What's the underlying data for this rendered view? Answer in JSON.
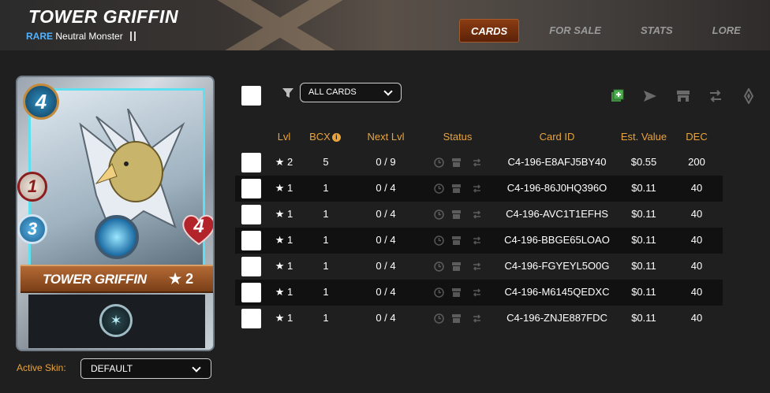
{
  "header": {
    "title": "TOWER GRIFFIN",
    "rarity": "RARE",
    "type_text": "Neutral Monster",
    "tabs": [
      {
        "label": "CARDS",
        "active": true
      },
      {
        "label": "FOR SALE",
        "active": false
      },
      {
        "label": "STATS",
        "active": false
      },
      {
        "label": "LORE",
        "active": false
      }
    ]
  },
  "card": {
    "name": "TOWER GRIFFIN",
    "level_text": "★ 2",
    "mana": "4",
    "melee": "1",
    "speed": "3",
    "health": "4"
  },
  "skin": {
    "label": "Active Skin:",
    "value": "DEFAULT"
  },
  "filter": {
    "value": "ALL CARDS"
  },
  "toolbar": {
    "icons": [
      "add-to-deck-icon",
      "send-icon",
      "market-icon",
      "transfer-icon",
      "burn-icon"
    ]
  },
  "table": {
    "headers": {
      "lvl": "Lvl",
      "bcx": "BCX",
      "next_lvl": "Next Lvl",
      "status": "Status",
      "card_id": "Card ID",
      "est_value": "Est. Value",
      "dec": "DEC"
    },
    "rows": [
      {
        "lvl": "★ 2",
        "bcx": "5",
        "next": "0 / 9",
        "id": "C4-196-E8AFJ5BY40",
        "value": "$0.55",
        "dec": "200"
      },
      {
        "lvl": "★ 1",
        "bcx": "1",
        "next": "0 / 4",
        "id": "C4-196-86J0HQ396O",
        "value": "$0.11",
        "dec": "40"
      },
      {
        "lvl": "★ 1",
        "bcx": "1",
        "next": "0 / 4",
        "id": "C4-196-AVC1T1EFHS",
        "value": "$0.11",
        "dec": "40"
      },
      {
        "lvl": "★ 1",
        "bcx": "1",
        "next": "0 / 4",
        "id": "C4-196-BBGE65LOAO",
        "value": "$0.11",
        "dec": "40"
      },
      {
        "lvl": "★ 1",
        "bcx": "1",
        "next": "0 / 4",
        "id": "C4-196-FGYEYL5O0G",
        "value": "$0.11",
        "dec": "40"
      },
      {
        "lvl": "★ 1",
        "bcx": "1",
        "next": "0 / 4",
        "id": "C4-196-M6145QEDXC",
        "value": "$0.11",
        "dec": "40"
      },
      {
        "lvl": "★ 1",
        "bcx": "1",
        "next": "0 / 4",
        "id": "C4-196-ZNJE887FDC",
        "value": "$0.11",
        "dec": "40"
      }
    ]
  },
  "colors": {
    "accent": "#e9a43c",
    "rarity": "#4fb3ff",
    "active_tab": "#7a3010",
    "background": "#1f1f1f"
  }
}
